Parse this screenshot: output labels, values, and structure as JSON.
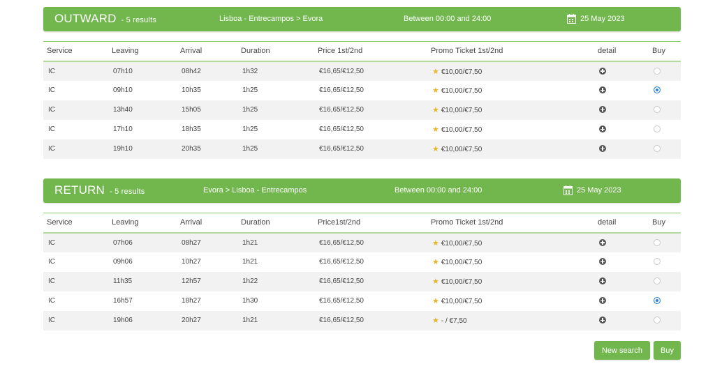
{
  "outward": {
    "title": "OUTWARD",
    "count": "- 5 results",
    "route": "Lisboa - Entrecampos > Evora",
    "time": "Between 00:00 and 24:00",
    "date": "25 May 2023",
    "headers": [
      "Service",
      "Leaving",
      "Arrival",
      "Duration",
      "Price 1st/2nd",
      "Promo Ticket 1st/2nd",
      "detail",
      "Buy"
    ],
    "rows": [
      {
        "service": "IC",
        "leaving": "07h10",
        "arrival": "08h42",
        "duration": "1h32",
        "price": "€16,65/€12,50",
        "promo": "€10,00/€7,50",
        "selected": false
      },
      {
        "service": "IC",
        "leaving": "09h10",
        "arrival": "10h35",
        "duration": "1h25",
        "price": "€16,65/€12,50",
        "promo": "€10,00/€7,50",
        "selected": true
      },
      {
        "service": "IC",
        "leaving": "13h40",
        "arrival": "15h05",
        "duration": "1h25",
        "price": "€16,65/€12,50",
        "promo": "€10,00/€7,50",
        "selected": false
      },
      {
        "service": "IC",
        "leaving": "17h10",
        "arrival": "18h35",
        "duration": "1h25",
        "price": "€16,65/€12,50",
        "promo": "€10,00/€7,50",
        "selected": false
      },
      {
        "service": "IC",
        "leaving": "19h10",
        "arrival": "20h35",
        "duration": "1h25",
        "price": "€16,65/€12,50",
        "promo": "€10,00/€7,50",
        "selected": false
      }
    ]
  },
  "return": {
    "title": "RETURN",
    "count": "- 5 results",
    "route": "Evora > Lisboa - Entrecampos",
    "time": "Between 00:00 and 24:00",
    "date": "25 May 2023",
    "headers": [
      "Service",
      "Leaving",
      "Arrival",
      "Duration",
      "Price1st/2nd",
      "Promo Ticket 1st/2nd",
      "detail",
      "Buy"
    ],
    "rows": [
      {
        "service": "IC",
        "leaving": "07h06",
        "arrival": "08h27",
        "duration": "1h21",
        "price": "€16,65/€12,50",
        "promo": "€10,00/€7,50",
        "selected": false
      },
      {
        "service": "IC",
        "leaving": "09h06",
        "arrival": "10h27",
        "duration": "1h21",
        "price": "€16,65/€12,50",
        "promo": "€10,00/€7,50",
        "selected": false
      },
      {
        "service": "IC",
        "leaving": "11h35",
        "arrival": "12h57",
        "duration": "1h22",
        "price": "€16,65/€12,50",
        "promo": "€10,00/€7,50",
        "selected": false
      },
      {
        "service": "IC",
        "leaving": "16h57",
        "arrival": "18h27",
        "duration": "1h30",
        "price": "€16,65/€12,50",
        "promo": "€10,00/€7,50",
        "selected": true
      },
      {
        "service": "IC",
        "leaving": "19h06",
        "arrival": "20h27",
        "duration": "1h21",
        "price": "€16,65/€12,50",
        "promo": "- / €7,50",
        "selected": false
      }
    ]
  },
  "icons": {
    "star": "star-icon",
    "detail": "plus-circle-icon",
    "calendar": "calendar-icon"
  },
  "colors": {
    "accent": "#72b74e",
    "selected": "#2a7fe0",
    "star": "#e7b62b"
  },
  "actions": {
    "new_search": "New search",
    "buy": "Buy"
  }
}
